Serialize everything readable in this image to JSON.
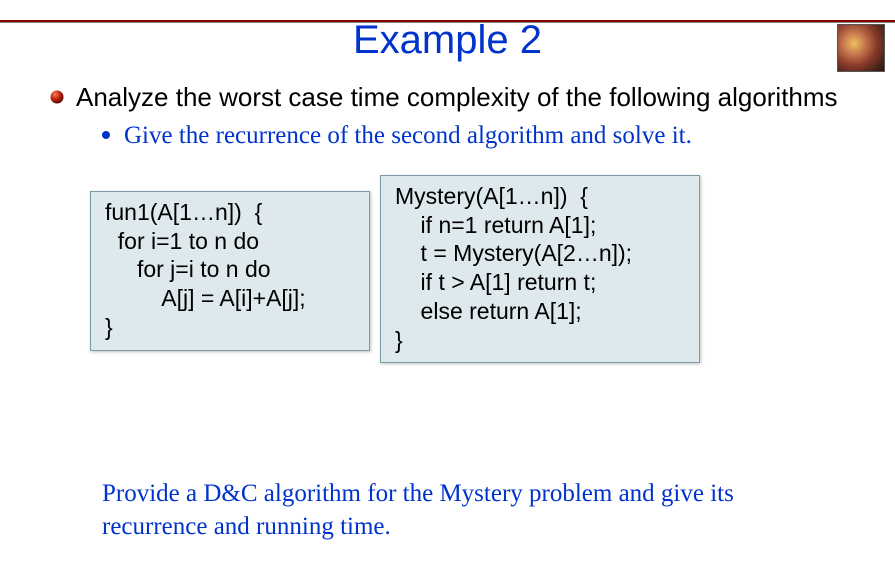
{
  "title": "Example 2",
  "bullet1": "Analyze the worst case time complexity of the following algorithms",
  "sub1": "Give the recurrence of the second algorithm and solve it.",
  "code_left": "fun1(A[1…n])  {\n  for i=1 to n do\n     for j=i to n do\n         A[j] = A[i]+A[j];\n}",
  "code_right": "Mystery(A[1…n])  {\n    if n=1 return A[1];\n    t = Mystery(A[2…n]);\n    if t > A[1] return t;\n    else return A[1];\n}",
  "footer": "Provide a D&C algorithm for the Mystery problem and give its recurrence and running time."
}
